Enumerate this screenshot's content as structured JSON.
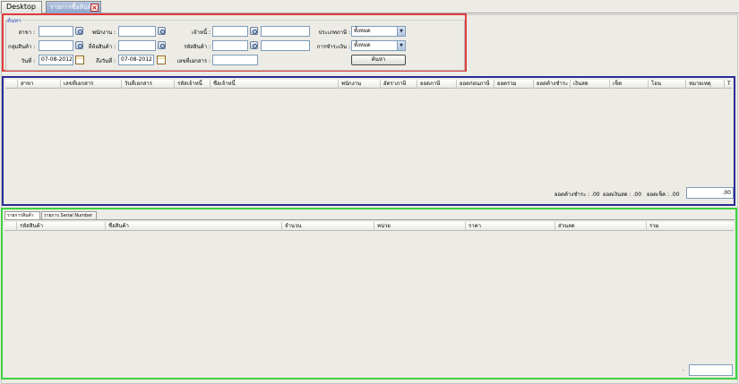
{
  "tabs": {
    "desktop": "Desktop",
    "active": "รายการซื้อสินค้า",
    "close_icon": "close-icon"
  },
  "search": {
    "title": "ค้นหา",
    "labels": {
      "branch": "สาขา :",
      "employee": "พนักงาน :",
      "creditor": "เจ้าหนี้ :",
      "tax_type": "ประเภทภาษี :",
      "product_group": "กลุ่มสินค้า :",
      "sku": "ยี่ห้อสินค้า :",
      "product_code": "รหัสสินค้า :",
      "payment": "การชำระเงิน :",
      "date": "วันที่ :",
      "to_date": "ถึงวันที่ :",
      "doc_no": "เลขที่เอกสาร :"
    },
    "values": {
      "branch": "",
      "employee": "",
      "creditor": "",
      "creditor_name": "",
      "tax_type": "ทั้งหมด",
      "product_group": "",
      "sku": "",
      "product_code": "",
      "product_name": "",
      "payment": "ทั้งหมด",
      "date": "07-08-2012",
      "to_date": "07-08-2012",
      "doc_no": ""
    },
    "button": "ค้นหา"
  },
  "purchase_grid": {
    "columns": [
      "สาขา",
      "เลขที่เอกสาร",
      "วันที่เอกสาร",
      "รหัสเจ้าหนี้",
      "ชื่อเจ้าหนี้",
      "พนักงาน",
      "อัตราภาษี",
      "ยอดภาษี",
      "ยอดก่อนภาษี",
      "ยอดรวม",
      "ยอดค้างชำระ",
      "เงินสด",
      "เช็ค",
      "โอน",
      "หมายเหตุ",
      "T"
    ]
  },
  "summary": {
    "outstanding_label": "ยอดค้างชำระ :",
    "outstanding_value": ".00",
    "cash_label": "ยอดเงินสด :",
    "cash_value": ".00",
    "cheque_label": "ยอดเช็ค :",
    "cheque_value": ".00",
    "total_value": ".00"
  },
  "detail": {
    "tabs": [
      "รายการสินค้า",
      "รายการ Serial Number"
    ],
    "columns": [
      "รหัสสินค้า",
      "ชื่อสินค้า",
      "จำนวน",
      "หน่วย",
      "ราคา",
      "ส่วนลด",
      "รวม"
    ],
    "footer_dot": ".",
    "footer_value": ""
  }
}
